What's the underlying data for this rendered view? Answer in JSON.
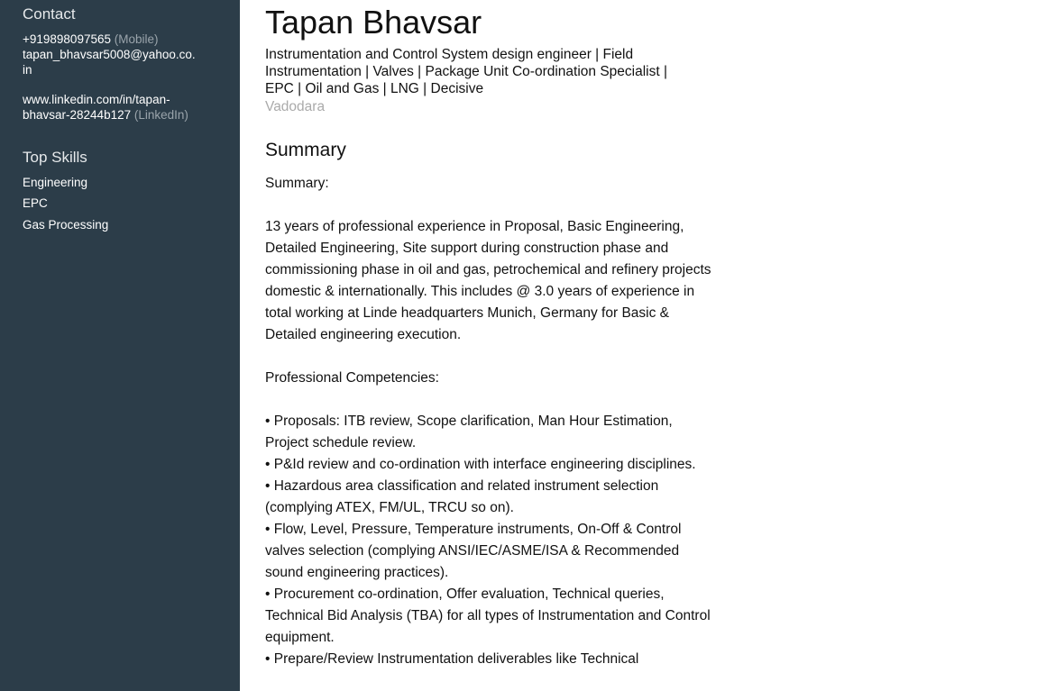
{
  "sidebar": {
    "contact": {
      "title": "Contact",
      "phone": "+919898097565",
      "phone_type": "(Mobile)",
      "email_line1": "tapan_bhavsar5008@yahoo.co.",
      "email_line2": "in",
      "linkedin_line1": "www.linkedin.com/in/tapan-",
      "linkedin_line2": "bhavsar-28244b127",
      "linkedin_type": "(LinkedIn)"
    },
    "top_skills": {
      "title": "Top Skills",
      "items": [
        "Engineering",
        "EPC",
        "Gas Processing"
      ]
    }
  },
  "profile": {
    "name": "Tapan Bhavsar",
    "headline": "Instrumentation and Control System design engineer | Field Instrumentation | Valves | Package Unit Co-ordination Specialist | EPC | Oil and Gas | LNG | Decisive",
    "location": "Vadodara"
  },
  "summary": {
    "title": "Summary",
    "label": "Summary:",
    "paragraph": "13 years of professional experience in Proposal, Basic Engineering, Detailed Engineering, Site support during construction phase and commissioning phase in oil and gas, petrochemical and refinery projects domestic & internationally. This includes @ 3.0 years of experience in total working at Linde headquarters Munich, Germany for Basic & Detailed engineering execution.",
    "competencies_label": "Professional Competencies:",
    "competencies": [
      "• Proposals: ITB review, Scope clarification, Man Hour Estimation, Project schedule review.",
      "• P&Id review and co-ordination with interface engineering disciplines.",
      "• Hazardous area classification and related instrument selection (complying ATEX, FM/UL, TRCU so on).",
      "• Flow, Level, Pressure, Temperature instruments, On-Off & Control valves selection (complying ANSI/IEC/ASME/ISA & Recommended sound engineering practices).",
      "• Procurement co-ordination, Offer evaluation, Technical queries, Technical Bid Analysis (TBA) for all types of Instrumentation and Control equipment.",
      "• Prepare/Review Instrumentation deliverables like Technical"
    ]
  }
}
